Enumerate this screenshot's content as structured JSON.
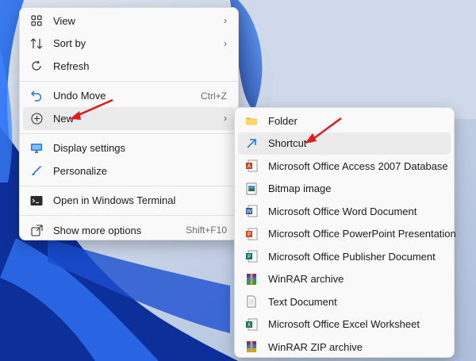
{
  "main_menu": {
    "items": [
      {
        "label": "View",
        "icon": "grid-icon",
        "has_submenu": true
      },
      {
        "label": "Sort by",
        "icon": "sort-icon",
        "has_submenu": true
      },
      {
        "label": "Refresh",
        "icon": "refresh-icon"
      },
      {
        "label": "Undo Move",
        "icon": "undo-icon",
        "shortcut": "Ctrl+Z"
      },
      {
        "label": "New",
        "icon": "plus-circle-icon",
        "has_submenu": true
      },
      {
        "label": "Display settings",
        "icon": "display-icon"
      },
      {
        "label": "Personalize",
        "icon": "brush-icon"
      },
      {
        "label": "Open in Windows Terminal",
        "icon": "terminal-icon"
      },
      {
        "label": "Show more options",
        "icon": "share-icon",
        "shortcut": "Shift+F10"
      }
    ]
  },
  "sub_menu": {
    "items": [
      {
        "label": "Folder",
        "icon": "folder-icon"
      },
      {
        "label": "Shortcut",
        "icon": "shortcut-icon"
      },
      {
        "label": "Microsoft Office Access 2007 Database",
        "icon": "access-icon"
      },
      {
        "label": "Bitmap image",
        "icon": "bitmap-icon"
      },
      {
        "label": "Microsoft Office Word Document",
        "icon": "word-icon"
      },
      {
        "label": "Microsoft Office PowerPoint Presentation",
        "icon": "powerpoint-icon"
      },
      {
        "label": "Microsoft Office Publisher Document",
        "icon": "publisher-icon"
      },
      {
        "label": "WinRAR archive",
        "icon": "winrar-icon"
      },
      {
        "label": "Text Document",
        "icon": "text-document-icon"
      },
      {
        "label": "Microsoft Office Excel Worksheet",
        "icon": "excel-icon"
      },
      {
        "label": "WinRAR ZIP archive",
        "icon": "winrar-zip-icon"
      }
    ]
  },
  "colors": {
    "wallpaper_dark": "#0a2a8a",
    "wallpaper_mid": "#1e5ad6",
    "wallpaper_light": "#9fb4d8",
    "annotation_arrow": "#e01b1b",
    "menu_bg": "#f9f9f9",
    "hover_bg": "#ebebeb"
  }
}
